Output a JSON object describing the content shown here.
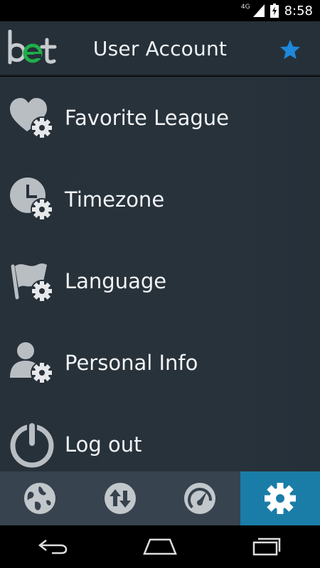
{
  "status_bar": {
    "network": "4G",
    "time": "8:58"
  },
  "app_bar": {
    "logo": "bet",
    "title": "User Account",
    "favorite_icon": "star-icon"
  },
  "menu": {
    "items": [
      {
        "label": "Favorite League",
        "icon": "heart-gear-icon"
      },
      {
        "label": "Timezone",
        "icon": "clock-gear-icon"
      },
      {
        "label": "Language",
        "icon": "flag-gear-icon"
      },
      {
        "label": "Personal Info",
        "icon": "user-gear-icon"
      },
      {
        "label": "Log out",
        "icon": "power-icon"
      }
    ]
  },
  "bottom_nav": {
    "tabs": [
      {
        "icon": "globe-icon",
        "active": false
      },
      {
        "icon": "up-down-arrows-icon",
        "active": false
      },
      {
        "icon": "speedometer-icon",
        "active": false
      },
      {
        "icon": "settings-gear-icon",
        "active": true
      }
    ]
  },
  "colors": {
    "accent": "#1a7da8",
    "star": "#1e88d9",
    "logo_green": "#1fae4a",
    "icon_gray": "#b9bec3"
  }
}
